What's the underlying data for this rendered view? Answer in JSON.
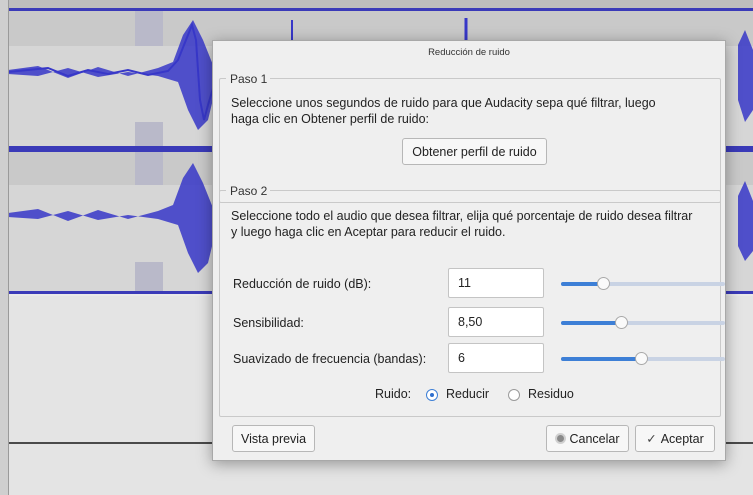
{
  "dialog": {
    "title": "Reducción de ruido",
    "step1": {
      "legend": "Paso 1",
      "description_line1": "Seleccione unos segundos de ruido para que Audacity sepa qué filtrar, luego",
      "description_line2": "haga clic en Obtener perfil de ruido:",
      "button": "Obtener perfil de ruido"
    },
    "step2": {
      "legend": "Paso 2",
      "description_line1": "Seleccione todo el audio que desea filtrar, elija qué porcentaje de ruido desea filtrar",
      "description_line2": "y luego haga clic en Aceptar para reducir el ruido.",
      "rows": [
        {
          "label": "Reducción de ruido (dB):",
          "value": "11",
          "slider_fraction": 0.24
        },
        {
          "label": "Sensibilidad:",
          "value": "8,50",
          "slider_fraction": 0.36
        },
        {
          "label": "Suavizado de frecuencia (bandas):",
          "value": "6",
          "slider_fraction": 0.49
        }
      ],
      "noise_label": "Ruido:",
      "options": [
        {
          "label": "Reducir",
          "selected": true
        },
        {
          "label": "Residuo",
          "selected": false
        }
      ]
    },
    "buttons": {
      "preview": "Vista previa",
      "cancel": "Cancelar",
      "ok": "Aceptar",
      "cancel_icon": "cancel-circle-icon",
      "ok_icon": "checkmark-icon"
    }
  },
  "colors": {
    "waveform": "#3737c8",
    "track_border": "#3a3ab8",
    "slider_fill": "#3d7fd6"
  }
}
